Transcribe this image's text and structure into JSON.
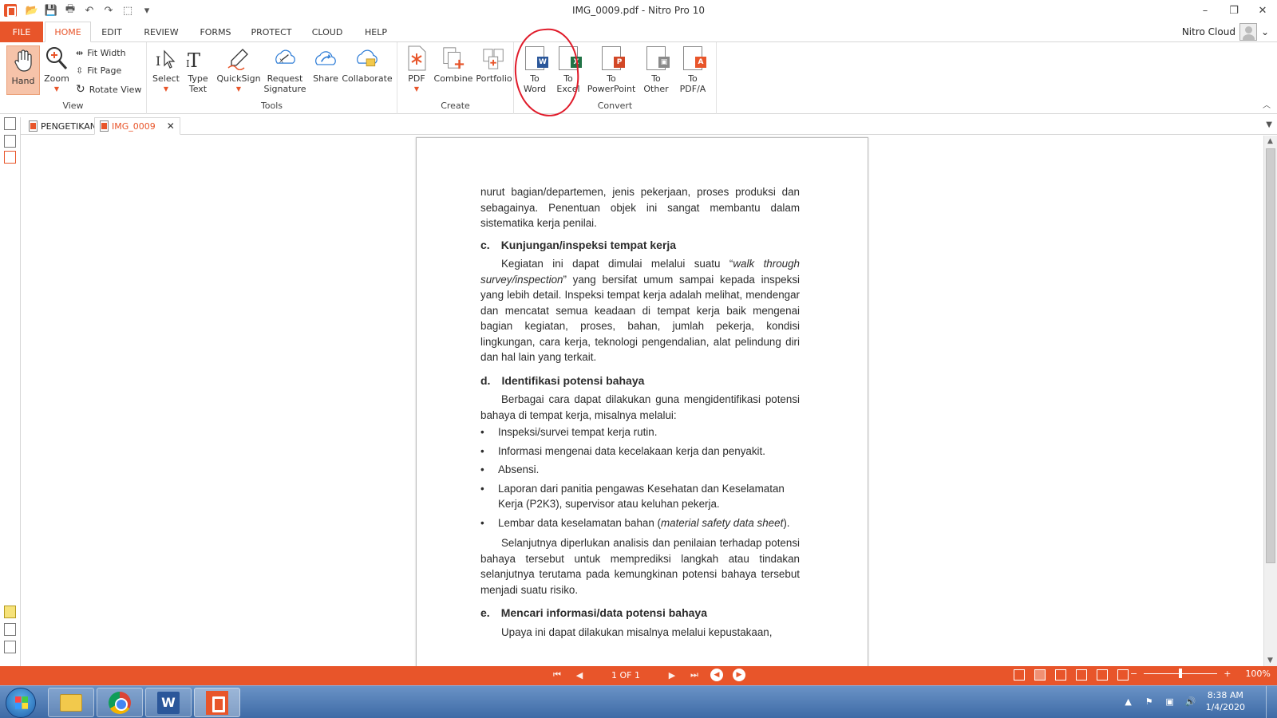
{
  "window": {
    "title": "IMG_0009.pdf - Nitro Pro 10",
    "minimize": "–",
    "restore": "❐",
    "close": "✕"
  },
  "qat": {
    "open": "📂",
    "save": "💾",
    "print": "🖶",
    "undo": "↶",
    "redo": "↷",
    "select": "⬚",
    "customize": "▾"
  },
  "menu": {
    "file": "FILE",
    "tabs": [
      "HOME",
      "EDIT",
      "REVIEW",
      "FORMS",
      "PROTECT",
      "CLOUD",
      "HELP"
    ],
    "active_tab": "HOME",
    "cloud_user": "Nitro Cloud"
  },
  "ribbon": {
    "view": {
      "label": "View",
      "hand": "Hand",
      "zoom": "Zoom",
      "fit_width": "Fit Width",
      "fit_page": "Fit Page",
      "rotate_view": "Rotate View"
    },
    "tools": {
      "label": "Tools",
      "select": "Select",
      "type_text_1": "Type",
      "type_text_2": "Text",
      "quicksign": "QuickSign",
      "request_signature_1": "Request",
      "request_signature_2": "Signature",
      "share": "Share",
      "collaborate": "Collaborate"
    },
    "create": {
      "label": "Create",
      "pdf": "PDF",
      "combine": "Combine",
      "portfolio": "Portfolio"
    },
    "convert": {
      "label": "Convert",
      "to_word_1": "To",
      "to_word_2": "Word",
      "to_excel_1": "To",
      "to_excel_2": "Excel",
      "to_powerpoint_1": "To",
      "to_powerpoint_2": "PowerPoint",
      "to_other_1": "To",
      "to_other_2": "Other",
      "to_pdfa_1": "To",
      "to_pdfa_2": "PDF/A"
    }
  },
  "doc_tabs": [
    {
      "label": "PENGETIKAN",
      "active": false
    },
    {
      "label": "IMG_0009",
      "active": true
    }
  ],
  "page": {
    "intro": "nurut bagian/departemen, jenis pekerjaan, proses produksi dan sebagainya. Penentuan objek ini sangat membantu dalam sistematika kerja penilai.",
    "section_c_letter": "c.",
    "section_c_title": "Kunjungan/inspeksi tempat kerja",
    "section_c_body_1": "Kegiatan ini dapat dimulai melalui suatu “",
    "section_c_body_em": "walk through survey/inspection",
    "section_c_body_2": "” yang bersifat umum sampai kepada inspeksi yang lebih detail. Inspeksi tempat kerja adalah melihat, mendengar dan mencatat semua keadaan di tempat kerja baik mengenai bagian kegiatan, proses, bahan, jumlah pekerja, kondisi lingkungan, cara kerja, teknologi pengendalian, alat pelindung diri dan hal lain yang terkait.",
    "section_d_letter": "d.",
    "section_d_title": "Identifikasi potensi bahaya",
    "section_d_body": "Berbagai cara dapat dilakukan guna mengidentifikasi potensi bahaya di tempat kerja, misalnya melalui:",
    "bullets": [
      "Inspeksi/survei tempat kerja rutin.",
      "Informasi mengenai data kecelakaan kerja dan penyakit.",
      "Absensi.",
      "Laporan dari panitia pengawas Kesehatan dan Keselamatan Kerja (P2K3), supervisor atau keluhan pekerja."
    ],
    "bullet_last_1": "Lembar data keselamatan bahan (",
    "bullet_last_em": "material safety data sheet",
    "bullet_last_2": ").",
    "section_d_after": "Selanjutnya diperlukan analisis dan penilaian terhadap potensi bahaya tersebut untuk memprediksi langkah atau tindakan selanjutnya terutama pada kemungkinan potensi bahaya tersebut menjadi suatu risiko.",
    "section_e_letter": "e.",
    "section_e_title": "Mencari informasi/data potensi bahaya",
    "section_e_body": "Upaya ini dapat dilakukan misalnya melalui kepustakaan,"
  },
  "status": {
    "page_indicator": "1 OF 1",
    "zoom": "100%",
    "zoom_fraction": 0.5
  },
  "taskbar": {
    "time": "8:38 AM",
    "date": "1/4/2020"
  },
  "colors": {
    "accent": "#e8552a",
    "annotation": "#e01b2a"
  }
}
